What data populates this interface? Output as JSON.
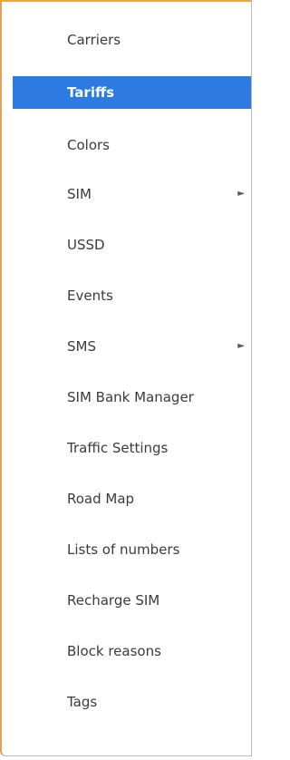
{
  "menu": {
    "items": [
      {
        "label": "Carriers"
      },
      {
        "label": "Tariffs",
        "selected": true
      },
      {
        "label": "Colors"
      },
      {
        "label": "SIM",
        "submenu_icon": "triangle-right-icon"
      },
      {
        "label": "USSD"
      },
      {
        "label": "Events"
      },
      {
        "label": "SMS",
        "submenu_icon": "triangle-right-icon"
      },
      {
        "label": "SIM Bank Manager"
      },
      {
        "label": "Traffic Settings"
      },
      {
        "label": "Road Map"
      },
      {
        "label": "Lists of numbers"
      },
      {
        "label": "Recharge SIM"
      },
      {
        "label": "Block reasons"
      },
      {
        "label": "Tags"
      }
    ],
    "submenu_arrow_glyph": "►"
  },
  "colors": {
    "selected_background": "#2d7be0",
    "selected_text": "#ffffff",
    "text": "#3b3b3b",
    "accent_border": "#f0a63c"
  }
}
